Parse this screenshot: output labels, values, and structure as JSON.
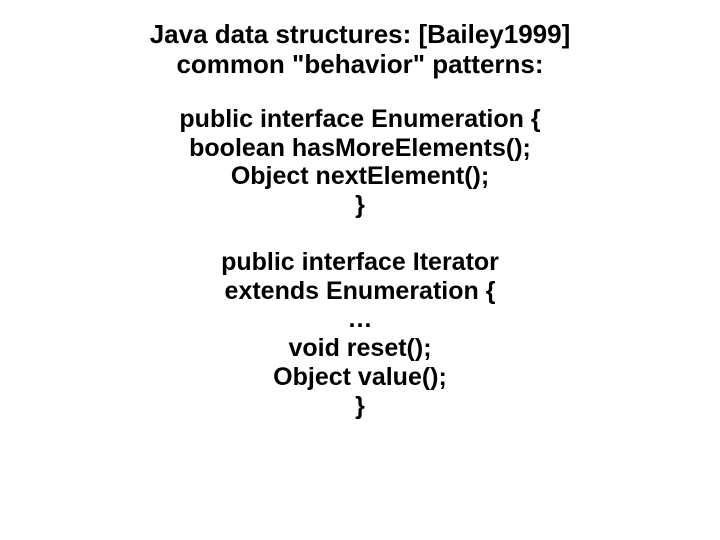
{
  "header": {
    "line1": "Java data structures:  [Bailey1999]",
    "line2": "common \"behavior\" patterns:"
  },
  "block1": {
    "l1": "public interface Enumeration  {",
    "l2": "boolean hasMoreElements();",
    "l3": "Object nextElement();",
    "l4": "}"
  },
  "block2": {
    "l1": "public interface Iterator",
    "l2": "extends Enumeration {",
    "l3": "…",
    "l4": "void reset();",
    "l5": "Object value();",
    "l6": "}"
  }
}
